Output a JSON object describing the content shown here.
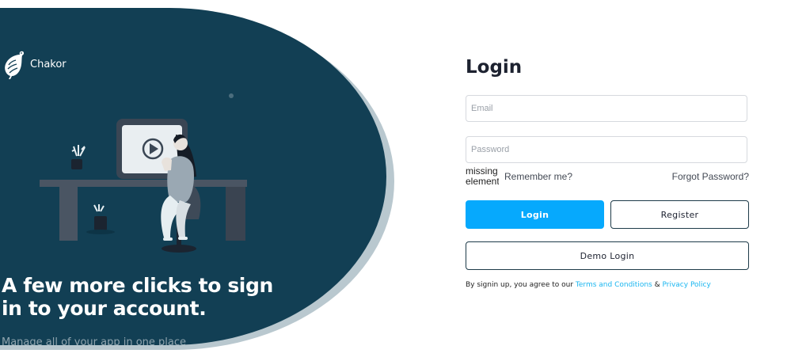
{
  "brand": {
    "name": "Chakor"
  },
  "hero": {
    "heading": "A few more clicks to sign in to your account.",
    "subtext": "Manage all of your app in one place"
  },
  "login_form": {
    "title": "Login",
    "email_placeholder": "Email",
    "password_placeholder": "Password",
    "missing_element_text": "missing element",
    "remember_label": "Remember me?",
    "forgot_label": "Forgot Password?",
    "login_button": "Login",
    "register_button": "Register",
    "demo_button": "Demo Login",
    "terms_prefix": "By signin up, you agree to our",
    "terms_link": "Terms and Conditions",
    "terms_joiner": "&",
    "privacy_link": "Privacy Policy"
  },
  "colors": {
    "hero_background": "#123f54",
    "primary": "#06a9fd",
    "link": "#1ab6f0"
  }
}
